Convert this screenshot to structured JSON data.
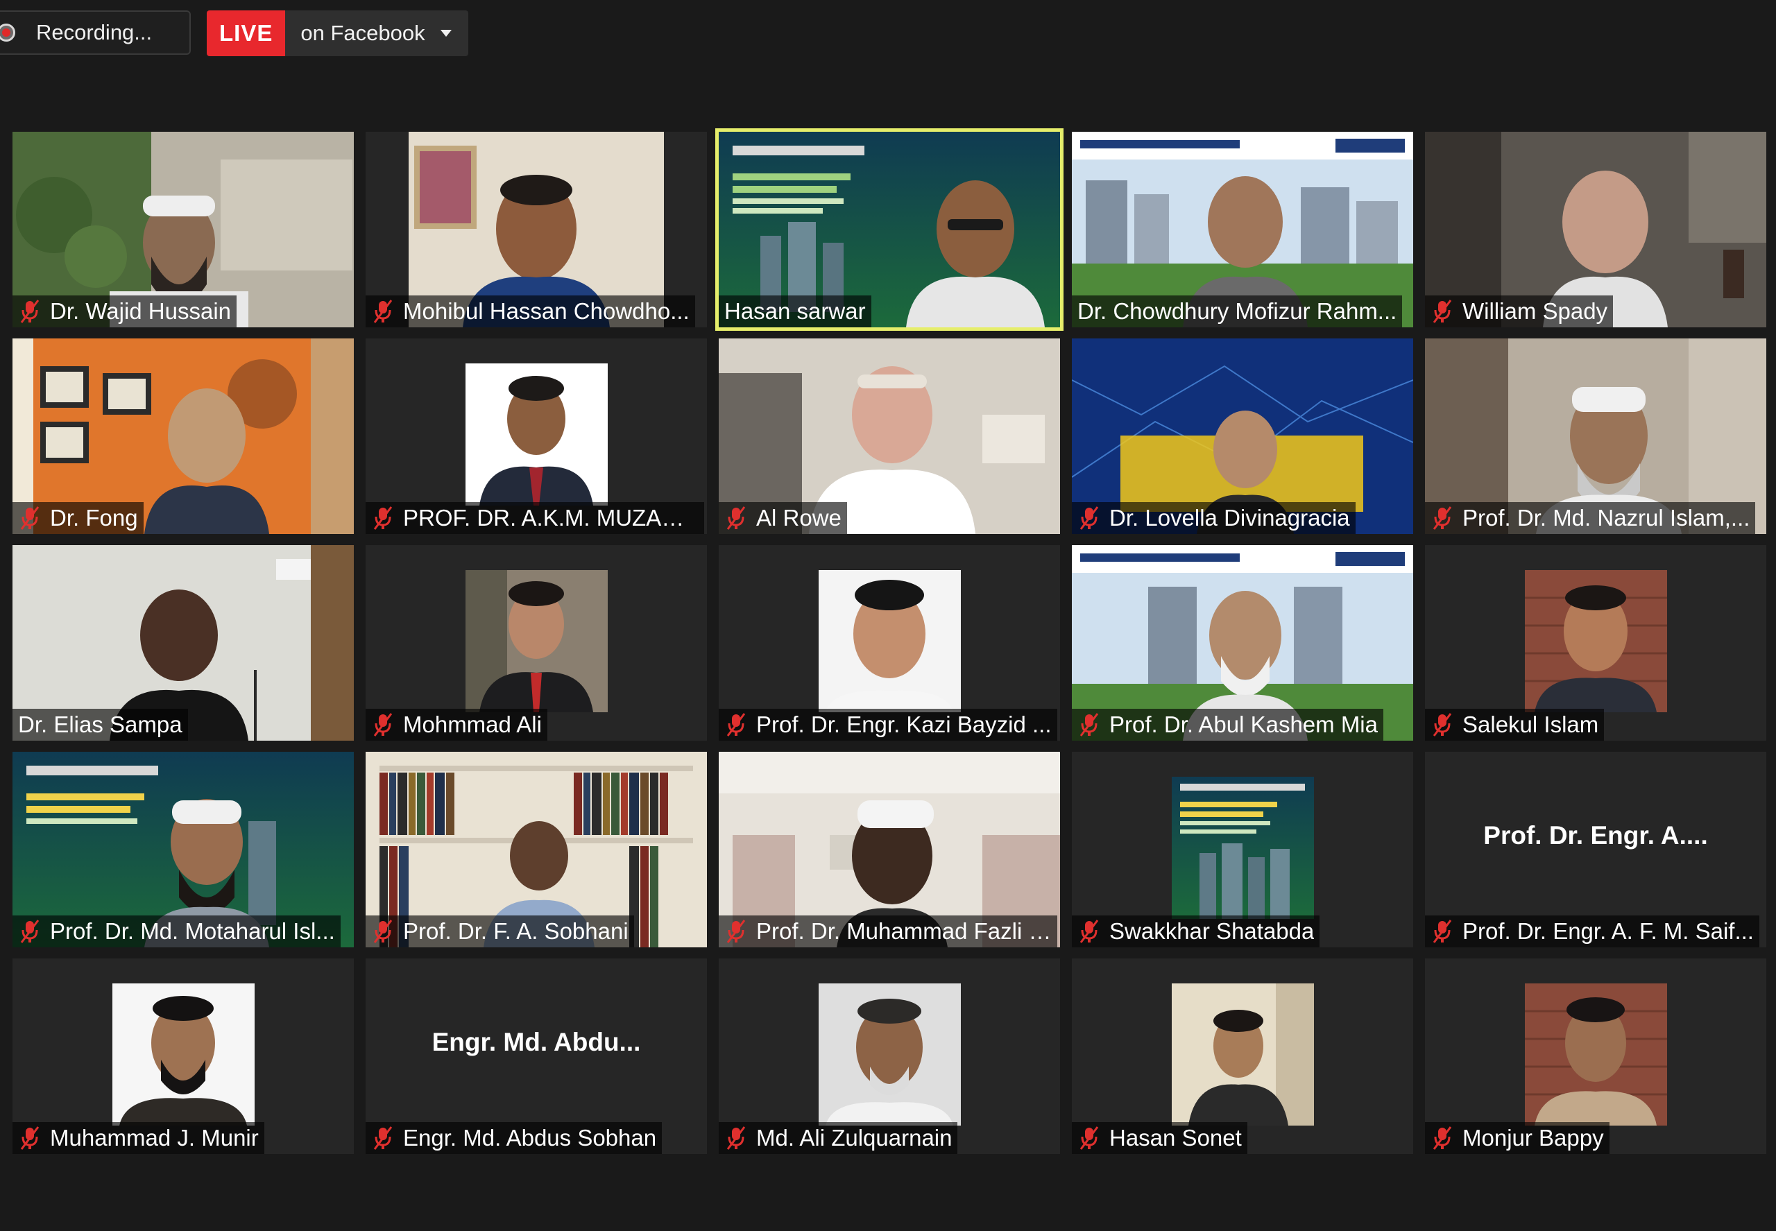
{
  "toolbar": {
    "recording_label": "Recording...",
    "live_label": "LIVE",
    "live_target": "on Facebook"
  },
  "colors": {
    "live_red": "#e8282d",
    "active_speaker_outline": "#e6ee6b",
    "muted_icon": "#e0302e",
    "background": "#1a1a1a"
  },
  "participants": [
    {
      "name": "Dr. Wajid Hussain",
      "muted": true
    },
    {
      "name": "Mohibul Hassan Chowdho...",
      "muted": true
    },
    {
      "name": "Hasan sarwar",
      "muted": false,
      "active_speaker": true
    },
    {
      "name": "Dr. Chowdhury Mofizur Rahm...",
      "muted": false
    },
    {
      "name": "William Spady",
      "muted": true
    },
    {
      "name": "Dr. Fong",
      "muted": true
    },
    {
      "name": "PROF. DR. A.K.M. MUZAHI...",
      "muted": true
    },
    {
      "name": "Al Rowe",
      "muted": true
    },
    {
      "name": "Dr. Lovella Divinagracia",
      "muted": true
    },
    {
      "name": "Prof.  Dr. Md. Nazrul Islam,...",
      "muted": true
    },
    {
      "name": "Dr. Elias Sampa",
      "muted": false
    },
    {
      "name": "Mohmmad Ali",
      "muted": true
    },
    {
      "name": "Prof. Dr. Engr. Kazi Bayzid ...",
      "muted": true
    },
    {
      "name": "Prof. Dr. Abul Kashem Mia",
      "muted": true
    },
    {
      "name": "Salekul Islam",
      "muted": true
    },
    {
      "name": "Prof. Dr. Md. Motaharul Isl...",
      "muted": true
    },
    {
      "name": "Prof. Dr. F. A. Sobhani",
      "muted": true
    },
    {
      "name": "Prof. Dr. Muhammad Fazli I...",
      "muted": true
    },
    {
      "name": "Swakkhar Shatabda",
      "muted": true
    },
    {
      "name": "Prof. Dr. Engr. A. F. M. Saif...",
      "muted": true,
      "avatar_text": "Prof. Dr. Engr. A...."
    },
    {
      "name": "Muhammad J. Munir",
      "muted": true
    },
    {
      "name": "Engr. Md. Abdus Sobhan",
      "muted": true,
      "avatar_text": "Engr. Md. Abdu..."
    },
    {
      "name": "Md. Ali Zulquarnain",
      "muted": true
    },
    {
      "name": "Hasan Sonet",
      "muted": true
    },
    {
      "name": "Monjur Bappy",
      "muted": true
    }
  ]
}
